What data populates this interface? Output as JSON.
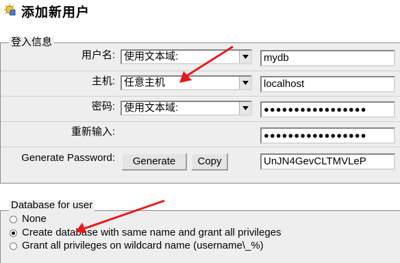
{
  "page": {
    "title": "添加新用户"
  },
  "login_info": {
    "legend": "登入信息",
    "username": {
      "label": "用户名:",
      "select_value": "使用文本域:",
      "value": "mydb"
    },
    "host": {
      "label": "主机:",
      "select_value": "任意主机",
      "value": "localhost"
    },
    "password": {
      "label": "密码:",
      "select_value": "使用文本域:",
      "value": "●●●●●●●●●●●●●●●●●"
    },
    "reenter": {
      "label": "重新输入:",
      "value": "●●●●●●●●●●●●●●●●●"
    },
    "generate": {
      "label": "Generate Password:",
      "generate_button": "Generate",
      "copy_button": "Copy",
      "value": "UnJN4GevCLTMVLeP"
    }
  },
  "database_for_user": {
    "legend": "Database for user",
    "options": [
      {
        "label": "None",
        "selected": false
      },
      {
        "label": "Create database with same name and grant all privileges",
        "selected": true
      },
      {
        "label": "Grant all privileges on wildcard name (username\\_%)",
        "selected": false
      }
    ]
  },
  "annotation_color": "#e8191c",
  "icons": {
    "header": "add-user-icon",
    "dropdown": "chevron-down-icon"
  }
}
